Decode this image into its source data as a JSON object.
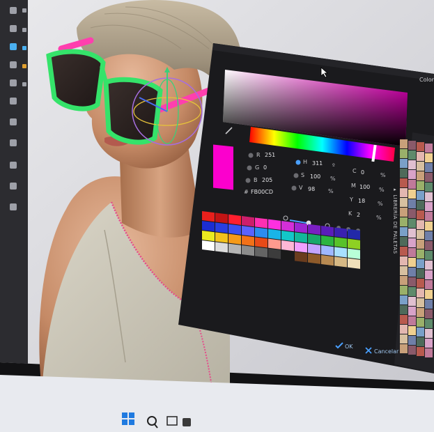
{
  "color_picker": {
    "rgb": {
      "r_label": "R",
      "r_value": "251",
      "g_label": "G",
      "g_value": "0",
      "b_label": "B",
      "b_value": "205",
      "hex_label": "#",
      "hex_value": "FB00CD"
    },
    "hsv": {
      "h_label": "H",
      "h_value": "311",
      "h_unit": "º",
      "s_label": "S",
      "s_value": "100",
      "s_unit": "%",
      "v_label": "V",
      "v_value": "98",
      "v_unit": "%"
    },
    "cmyk": {
      "c_label": "C",
      "c_value": "0",
      "c_unit": "%",
      "m_label": "M",
      "m_value": "100",
      "m_unit": "%",
      "y_label": "Y",
      "y_value": "18",
      "y_unit": "%",
      "k_label": "K",
      "k_value": "2",
      "k_unit": "%"
    },
    "ok_label": "OK",
    "cancel_label": "Cancelar",
    "palette_library_label": "▸ LIBRERÍA DE PALETAS",
    "top_right_label": "Color",
    "selected_color": "#fb00cd",
    "swatch_rows": [
      [
        "#e8201c",
        "#c21414",
        "#ff1f2e",
        "#cc1e6b",
        "#ff2fb2",
        "#ff30e0",
        "#d42fd8",
        "#9d26d2",
        "#7a1ec2",
        "#5a1cb9",
        "#3a20b0",
        "#2229a8"
      ],
      [
        "#1c2dd2",
        "#2a3ee0",
        "#3c4ff0",
        "#5a62ff",
        "#2c8cf0",
        "#19b4e8",
        "#13c7c8",
        "#12b89a",
        "#18a86a",
        "#2cb440",
        "#58c22a",
        "#8ed023"
      ],
      [
        "#eaeb20",
        "#f2c21c",
        "#f69a18",
        "#f27118",
        "#e84a18",
        "#ff9a8e",
        "#ffb7d6",
        "#f2a0ff",
        "#c3a4ff",
        "#9fb8ff",
        "#a8e0ff",
        "#b8ffd8"
      ],
      [
        "#ffffff",
        "#dcdcdc",
        "#b4b4b4",
        "#8c8c8c",
        "#646464",
        "#3c3c3c",
        "#1a1a1a",
        "#6a3c1e",
        "#8e5a2a",
        "#b88a52",
        "#d6b884",
        "#f0dfba"
      ]
    ]
  }
}
